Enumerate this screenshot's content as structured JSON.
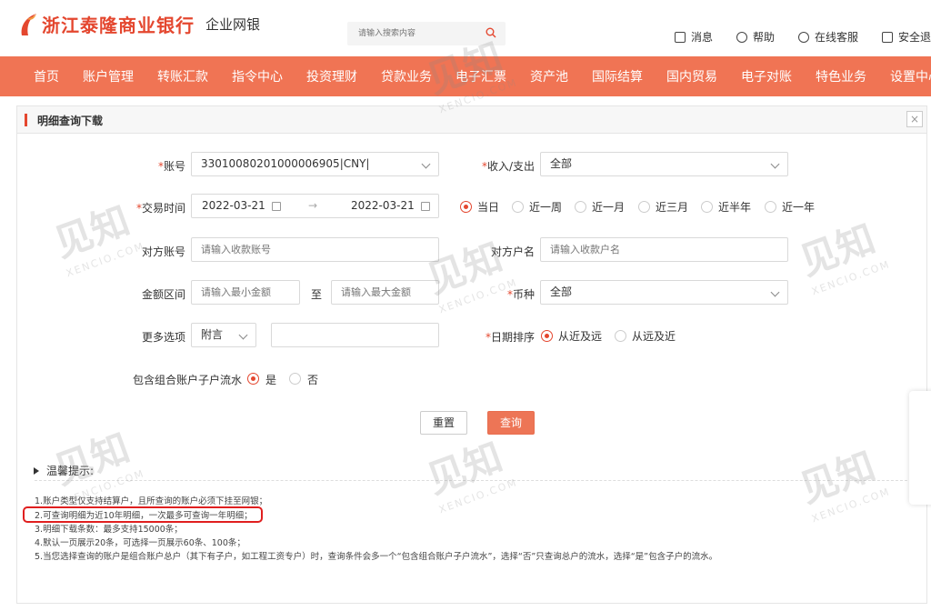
{
  "header": {
    "bank_name": "浙江泰隆商业银行",
    "system_name": "企业网银",
    "search_placeholder": "请输入搜索内容",
    "links": [
      {
        "label": "消息",
        "icon": "message-icon"
      },
      {
        "label": "帮助",
        "icon": "help-icon"
      },
      {
        "label": "在线客服",
        "icon": "headset-icon"
      },
      {
        "label": "安全退",
        "icon": "logout-icon"
      }
    ]
  },
  "nav": {
    "items": [
      "首页",
      "账户管理",
      "转账汇款",
      "指令中心",
      "投资理财",
      "贷款业务",
      "电子汇票",
      "资产池",
      "国际结算",
      "国内贸易",
      "电子对账",
      "特色业务",
      "设置中心"
    ]
  },
  "panel": {
    "title": "明细查询下载",
    "close": "×"
  },
  "form": {
    "account_label": "账号",
    "account_value": "33010080201000006905|CNY|",
    "income_label": "收入/支出",
    "income_value": "全部",
    "date_label": "交易时间",
    "date_start": "2022-03-21",
    "date_arrow": "→",
    "date_end": "2022-03-21",
    "date_ranges": [
      "当日",
      "近一周",
      "近一月",
      "近三月",
      "近半年",
      "近一年"
    ],
    "date_range_selected": "当日",
    "counter_account_label": "对方账号",
    "counter_account_placeholder": "请输入收款账号",
    "counter_name_label": "对方户名",
    "counter_name_placeholder": "请输入收款户名",
    "amount_label": "金额区间",
    "amount_min_placeholder": "请输入最小金额",
    "amount_to": "至",
    "amount_max_placeholder": "请输入最大金额",
    "currency_label": "币种",
    "currency_value": "全部",
    "more_label": "更多选项",
    "more_value": "附言",
    "sort_label": "日期排序",
    "sort_options": [
      "从近及远",
      "从远及近"
    ],
    "sort_selected": "从近及远",
    "sub_account_label": "包含组合账户子户流水",
    "sub_account_options": [
      "是",
      "否"
    ],
    "sub_account_selected": "是",
    "required_mark": "*"
  },
  "buttons": {
    "reset": "重置",
    "query": "查询"
  },
  "tips": {
    "title": "温馨提示:",
    "lines": [
      "1.账户类型仅支持结算户，且所查询的账户必须下挂至网银；",
      "2.可查询明细为近10年明细，一次最多可查询一年明细；",
      "3.明细下载条数：最多支持15000条；",
      "4.默认一页展示20条，可选择一页展示60条、100条；",
      "5.当您选择查询的账户是组合账户总户（其下有子户，如工程工资专户）时，查询条件会多一个“包含组合账户子户流水”，选择“否”只查询总户的流水，选择“是”包含子户的流水。"
    ]
  },
  "watermark": {
    "text": "见知",
    "sub": "XENCIO.COM"
  },
  "colors": {
    "brand": "#e4472f",
    "nav": "#f07454",
    "query_button": "#ed7556",
    "highlight": "#e01f1f"
  }
}
